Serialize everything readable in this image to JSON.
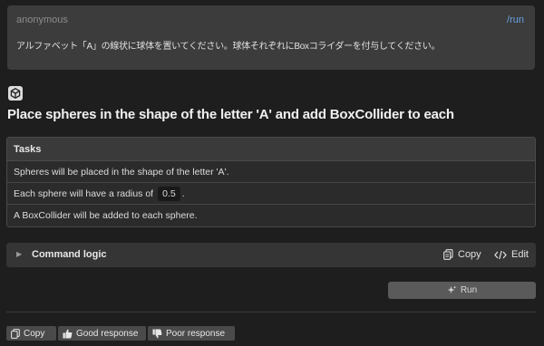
{
  "user_message": {
    "author": "anonymous",
    "command": "/run",
    "text": "アルファベット「A」の線状に球体を置いてください。球体それぞれにBoxコライダーを付与してください。"
  },
  "assistant": {
    "avatar_icon": "unity-logo-icon",
    "title": "Place spheres in the shape of the letter 'A' and add BoxCollider to each"
  },
  "tasks": {
    "header": "Tasks",
    "rows": [
      {
        "text": "Spheres will be placed in the shape of the letter 'A'."
      },
      {
        "prefix": "Each sphere will have a radius of",
        "code": "0.5",
        "suffix": "."
      },
      {
        "text": "A BoxCollider will be added to each sphere."
      }
    ]
  },
  "command_logic": {
    "label": "Command logic",
    "copy_label": "Copy",
    "edit_label": "Edit"
  },
  "run_button": {
    "label": "Run",
    "icon": "sparkle-icon"
  },
  "feedback": {
    "copy_label": "Copy",
    "good_label": "Good response",
    "poor_label": "Poor response"
  },
  "colors": {
    "background": "#1e1e1e",
    "card": "#3c3c3c",
    "link": "#6aa0e6"
  }
}
